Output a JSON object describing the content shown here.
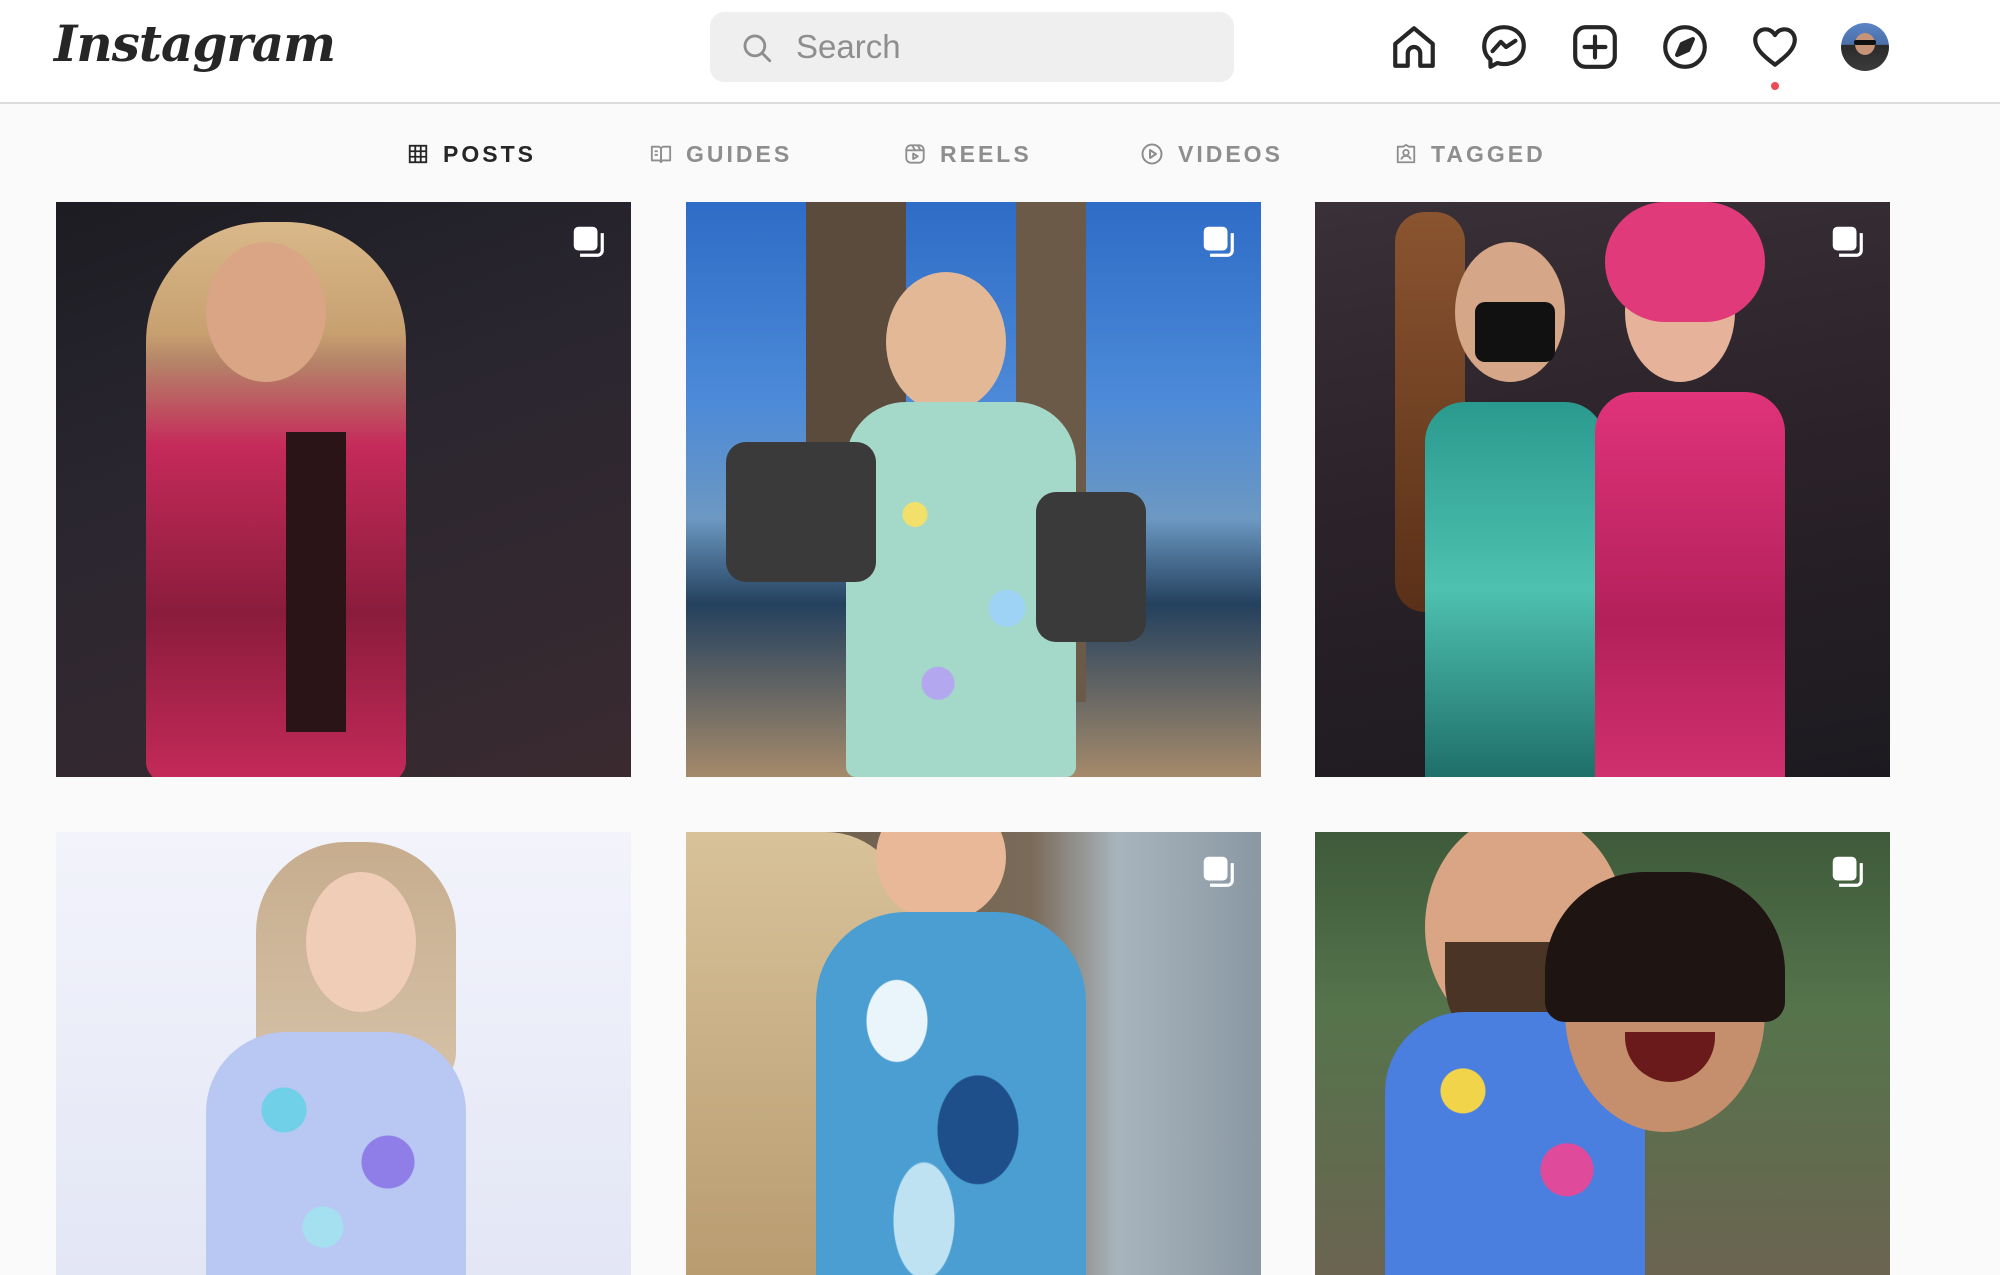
{
  "app": {
    "logo_text": "Instagram"
  },
  "search": {
    "placeholder": "Search",
    "value": ""
  },
  "nav": {
    "icons": [
      "home-icon",
      "messenger-icon",
      "new-post-icon",
      "explore-icon",
      "activity-heart-icon",
      "profile-avatar"
    ],
    "notification_dot_color": "#ed4956"
  },
  "tabs": [
    {
      "label": "POSTS",
      "icon": "grid-icon",
      "active": true
    },
    {
      "label": "GUIDES",
      "icon": "guide-book-icon",
      "active": false
    },
    {
      "label": "REELS",
      "icon": "reels-icon",
      "active": false
    },
    {
      "label": "VIDEOS",
      "icon": "play-circle-icon",
      "active": false
    },
    {
      "label": "TAGGED",
      "icon": "tagged-user-icon",
      "active": false
    }
  ],
  "posts": [
    {
      "description": "woman with blonde hair in pink and black crackle print outfit at night event",
      "multi": true
    },
    {
      "description": "woman in floral print dress by lake with palm trees",
      "multi": true
    },
    {
      "description": "two women in teal and pink crackle outfits at event",
      "multi": true
    },
    {
      "description": "woman in floral print bodysuit against white wall",
      "multi": false
    },
    {
      "description": "woman in blue marble print dress",
      "multi": true
    },
    {
      "description": "couple hugging in colorful outfits outdoors",
      "multi": true
    }
  ],
  "colors": {
    "text_primary": "#262626",
    "text_secondary": "#8e8e8e",
    "border": "#dbdbdb",
    "background": "#fafafa",
    "search_bg": "#efefef"
  }
}
